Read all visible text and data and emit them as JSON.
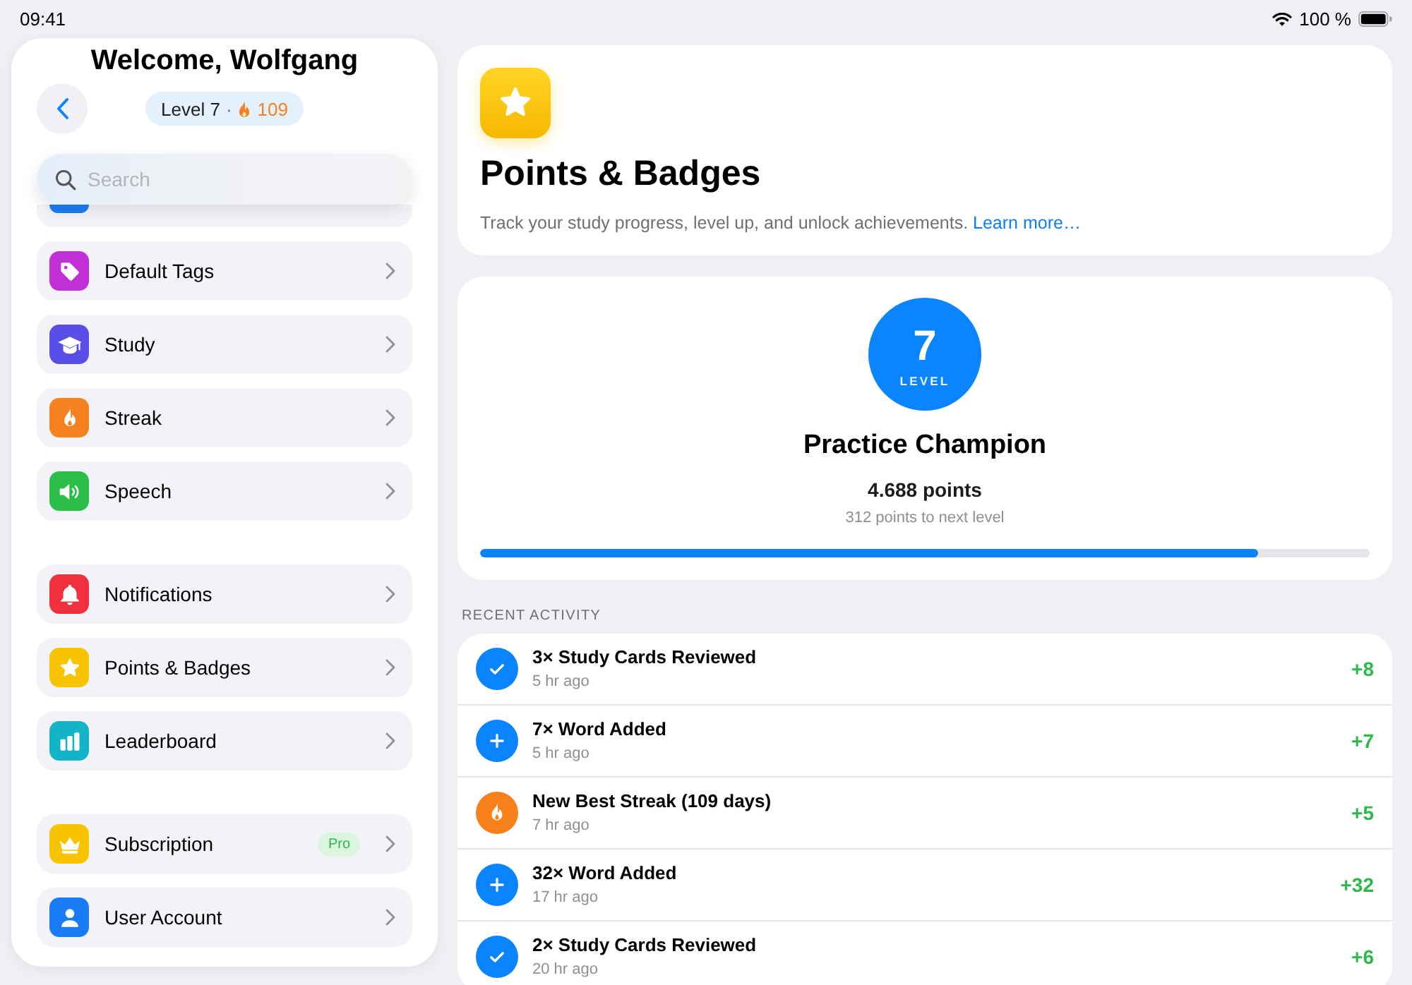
{
  "status_bar": {
    "time": "09:41",
    "battery": "100 %"
  },
  "sidebar": {
    "title": "Welcome, Wolfgang",
    "badge": {
      "level_label": "Level 7",
      "separator": "·",
      "streak": "109"
    },
    "search": {
      "placeholder": "Search"
    },
    "groups": [
      {
        "items": [
          {
            "kind": "covered",
            "color": "#1a7cf5"
          },
          {
            "kind": "link",
            "label": "Default Tags",
            "color": "#c12fd6"
          },
          {
            "kind": "link",
            "label": "Study",
            "color": "#5a4ee8"
          },
          {
            "kind": "link",
            "label": "Streak",
            "color": "#f5821f"
          },
          {
            "kind": "link",
            "label": "Speech",
            "color": "#2bbf4a"
          }
        ]
      },
      {
        "items": [
          {
            "kind": "link",
            "label": "Notifications",
            "color": "#f0303f"
          },
          {
            "kind": "link",
            "label": "Points & Badges",
            "color": "#f9c300"
          },
          {
            "kind": "link",
            "label": "Leaderboard",
            "color": "#14b4c8"
          }
        ]
      },
      {
        "items": [
          {
            "kind": "link",
            "label": "Subscription",
            "color": "#f9c300",
            "badge": "Pro"
          },
          {
            "kind": "link",
            "label": "User Account",
            "color": "#1a7cf5"
          }
        ]
      }
    ]
  },
  "header": {
    "title": "Points & Badges",
    "description": "Track your study progress, level up, and unlock achievements.",
    "link": "Learn more…"
  },
  "level_card": {
    "number": "7",
    "caption": "LEVEL",
    "title": "Practice Champion",
    "points": "4.688 points",
    "next": "312 points to next level",
    "progress": {
      "level": 0.875
    }
  },
  "activity": {
    "title": "RECENT ACTIVITY",
    "items": [
      {
        "kind": "review",
        "title": "3× Study Cards Reviewed",
        "time": "5 hr ago",
        "points": "+8"
      },
      {
        "kind": "word",
        "title": "7× Word Added",
        "time": "5 hr ago",
        "points": "+7"
      },
      {
        "kind": "streak",
        "title": "New Best Streak (109 days)",
        "time": "7 hr ago",
        "points": "+5"
      },
      {
        "kind": "word",
        "title": "32× Word Added",
        "time": "17 hr ago",
        "points": "+32"
      },
      {
        "kind": "review",
        "title": "2× Study Cards Reviewed",
        "time": "20 hr ago",
        "points": "+6"
      }
    ]
  }
}
